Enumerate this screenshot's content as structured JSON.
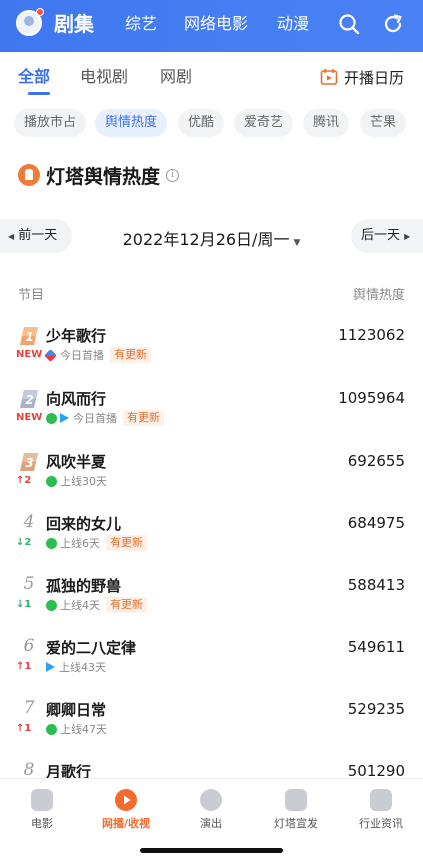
{
  "top_nav": {
    "tabs": [
      {
        "label": "剧集",
        "active": true
      },
      {
        "label": "综艺"
      },
      {
        "label": "网络电影"
      },
      {
        "label": "动漫"
      }
    ],
    "icons": [
      "search-icon",
      "refresh-icon"
    ]
  },
  "sub_tabs": {
    "items": [
      {
        "label": "全部",
        "active": true
      },
      {
        "label": "电视剧"
      },
      {
        "label": "网剧"
      }
    ],
    "calendar_label": "开播日历"
  },
  "filter_chips": [
    {
      "label": "播放市占"
    },
    {
      "label": "舆情热度",
      "active": true
    },
    {
      "label": "优酷"
    },
    {
      "label": "爱奇艺"
    },
    {
      "label": "腾讯"
    },
    {
      "label": "芒果"
    }
  ],
  "section": {
    "title": "灯塔舆情热度"
  },
  "date_nav": {
    "prev_label": "前一天",
    "date": "2022年12月26日/周一",
    "next_label": "后一天"
  },
  "table": {
    "col_program": "节目",
    "col_heat": "舆情热度",
    "rows": [
      {
        "rank": "1",
        "trend": "NEW",
        "trend_type": "new",
        "title": "少年歌行",
        "platform": "youku",
        "status": "今日首播",
        "updated": "有更新",
        "heat": "1123062"
      },
      {
        "rank": "2",
        "trend": "NEW",
        "trend_type": "new",
        "title": "向风而行",
        "platform": "iqiyi+tencent",
        "status": "今日首播",
        "updated": "有更新",
        "heat": "1095964"
      },
      {
        "rank": "3",
        "trend": "↑2",
        "trend_type": "up",
        "title": "风吹半夏",
        "platform": "iqiyi",
        "status": "上线30天",
        "updated": "",
        "heat": "692655"
      },
      {
        "rank": "4",
        "trend": "↓2",
        "trend_type": "down",
        "title": "回来的女儿",
        "platform": "iqiyi",
        "status": "上线6天",
        "updated": "有更新",
        "heat": "684975"
      },
      {
        "rank": "5",
        "trend": "↓1",
        "trend_type": "down",
        "title": "孤独的野兽",
        "platform": "iqiyi",
        "status": "上线4天",
        "updated": "有更新",
        "heat": "588413"
      },
      {
        "rank": "6",
        "trend": "↑1",
        "trend_type": "up",
        "title": "爱的二八定律",
        "platform": "tencent",
        "status": "上线43天",
        "updated": "",
        "heat": "549611"
      },
      {
        "rank": "7",
        "trend": "↑1",
        "trend_type": "up",
        "title": "卿卿日常",
        "platform": "iqiyi",
        "status": "上线47天",
        "updated": "",
        "heat": "529235"
      },
      {
        "rank": "8",
        "trend": "",
        "trend_type": "",
        "title": "月歌行",
        "platform": "",
        "status": "",
        "updated": "",
        "heat": "501290"
      }
    ]
  },
  "bottom_nav": [
    {
      "label": "电影"
    },
    {
      "label": "网播/收视",
      "active": true
    },
    {
      "label": "演出"
    },
    {
      "label": "灯塔宣发"
    },
    {
      "label": "行业资讯"
    }
  ],
  "colors": {
    "primary": "#3c72ee",
    "accent_orange": "#f36b2e",
    "up": "#e64340",
    "down": "#2fb36b"
  }
}
